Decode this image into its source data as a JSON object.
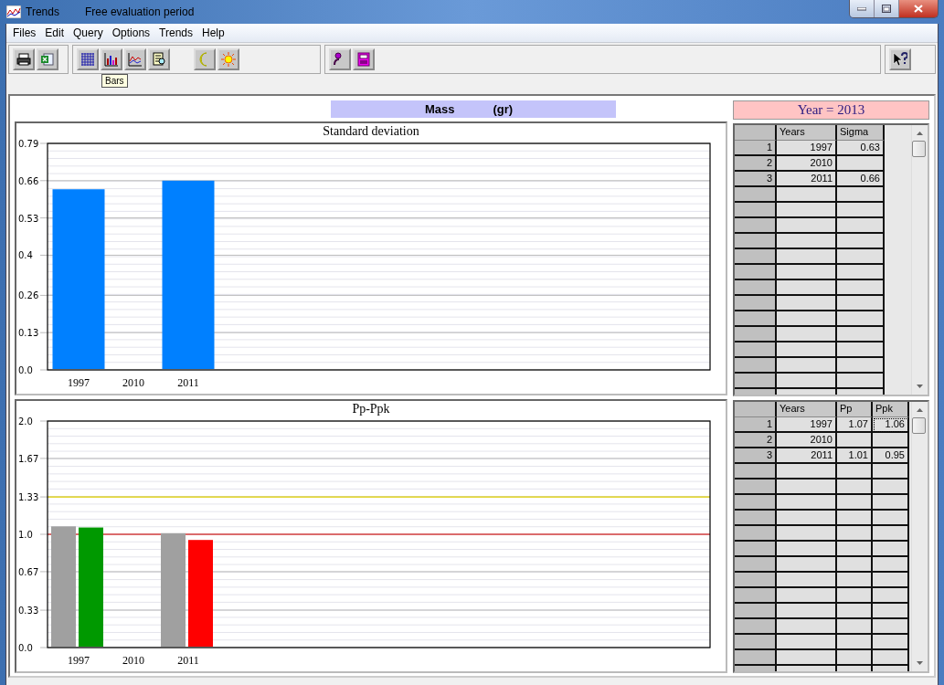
{
  "window": {
    "title": "Trends",
    "subtitle": "Free evaluation period"
  },
  "menu": [
    "Files",
    "Edit",
    "Query",
    "Options",
    "Trends",
    "Help"
  ],
  "toolbar": {
    "groups": [
      {
        "buttons": [
          {
            "kind": "print"
          },
          {
            "kind": "excel"
          }
        ]
      },
      {
        "buttons": [
          {
            "kind": "grid"
          },
          {
            "kind": "bars"
          },
          {
            "kind": "lines"
          },
          {
            "kind": "report"
          },
          {
            "kind": "gap"
          },
          {
            "kind": "moon"
          },
          {
            "kind": "sun"
          }
        ]
      },
      {
        "buttons": [
          {
            "kind": "people"
          },
          {
            "kind": "calculator"
          }
        ]
      },
      {
        "buttons": [
          {
            "kind": "help"
          }
        ]
      }
    ],
    "tooltip": "Bars"
  },
  "measure": {
    "name": "Mass",
    "unit": "(gr)"
  },
  "year_label": "Year = 2013",
  "charts": [
    {
      "title": "Standard deviation",
      "chart_data": {
        "type": "bar",
        "categories": [
          "1997",
          "2010",
          "2011"
        ],
        "series": [
          {
            "color": "#0080ff",
            "values": [
              0.63,
              null,
              0.66
            ]
          }
        ],
        "ylim": [
          0,
          0.79
        ],
        "grid": true,
        "yticks": [
          {
            "value": 0,
            "label": "0.0"
          },
          0.13,
          0.26,
          {
            "value": 0.4,
            "label": "0.4"
          },
          0.53,
          0.66,
          0.79
        ]
      }
    },
    {
      "title": "Pp-Ppk",
      "chart_data": {
        "type": "bar",
        "categories": [
          "1997",
          "2010",
          "2011"
        ],
        "series": [
          {
            "color": "#a0a0a0",
            "values": [
              1.07,
              null,
              1.01
            ]
          },
          {
            "color": "#009900",
            "values": [
              1.06,
              null,
              null
            ]
          },
          {
            "color": "#ff0000",
            "values": [
              null,
              null,
              0.95
            ]
          }
        ],
        "ylim": [
          0,
          2
        ],
        "grid": true,
        "yticks": [
          {
            "value": 0,
            "label": "0.0"
          },
          0.33,
          0.67,
          {
            "value": 1,
            "label": "1.0"
          },
          1.33,
          1.67,
          {
            "value": 2,
            "label": "2.0"
          }
        ],
        "ref_lines": [
          {
            "axis": "y",
            "value": 1.33,
            "color": "#e8d800"
          },
          {
            "axis": "y",
            "value": 1,
            "color": "#e00000"
          }
        ]
      }
    }
  ],
  "tables": [
    {
      "columns": [
        "Years",
        "Sigma"
      ],
      "rows": [
        {
          "index": "1",
          "cells": [
            {
              "text": "1997",
              "focused": false
            },
            {
              "text": "0.63",
              "focused": false
            }
          ]
        },
        {
          "index": "2",
          "cells": [
            {
              "text": "2010",
              "focused": false
            },
            {
              "focused": false
            }
          ]
        },
        {
          "index": "3",
          "cells": [
            {
              "text": "2011",
              "focused": false
            },
            {
              "text": "0.66",
              "focused": false
            }
          ]
        }
      ]
    },
    {
      "columns": [
        "Years",
        "Pp",
        "Ppk"
      ],
      "rows": [
        {
          "index": "1",
          "cells": [
            {
              "text": "1997",
              "focused": false
            },
            {
              "text": "1.07",
              "focused": false
            },
            {
              "text": "1.06",
              "focused": true
            }
          ]
        },
        {
          "index": "2",
          "cells": [
            {
              "text": "2010",
              "focused": false
            },
            {
              "focused": false
            },
            {
              "focused": false
            }
          ]
        },
        {
          "index": "3",
          "cells": [
            {
              "text": "2011",
              "focused": false
            },
            {
              "text": "1.01",
              "focused": false
            },
            {
              "text": "0.95",
              "focused": false
            }
          ]
        }
      ]
    }
  ]
}
